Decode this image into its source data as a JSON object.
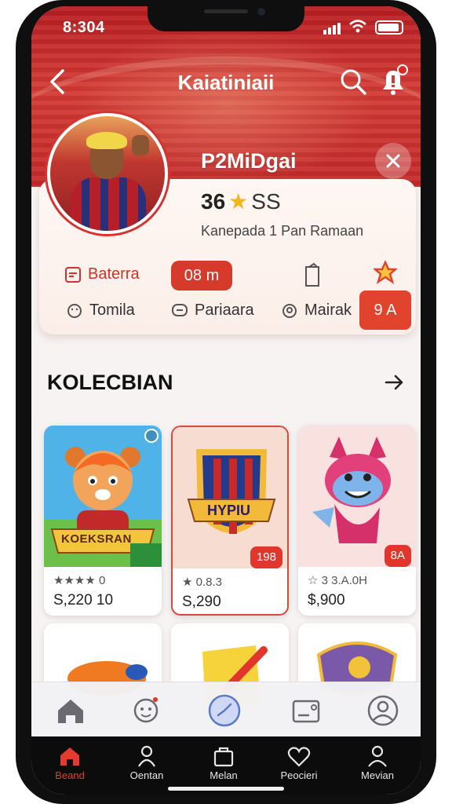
{
  "status_bar": {
    "time": "8:304"
  },
  "header": {
    "title": "Kaiatiniaii"
  },
  "profile": {
    "username": "P2MiDgai",
    "rating": "36",
    "rating_sub": "SS",
    "subtitle": "Kanepada  1 Pan Ramaan",
    "stats": {
      "row1_left": "Baterra",
      "row1_pill": "08 m",
      "row1_side": "9 A",
      "row2_a": "Tomila",
      "row2_b": "Pariaara",
      "row2_c": "Mairak"
    }
  },
  "collection": {
    "title": "KOLECBIAN",
    "items": [
      {
        "art_label": "KOEKSRAN",
        "meta": "★★★★ 0",
        "price": "S,220 10"
      },
      {
        "art_label": "HYPIU",
        "meta": "★ 0.8.3",
        "price": "S,290",
        "tag": "198"
      },
      {
        "art_label": "",
        "meta": "☆ 3 3.A.0H",
        "price": "$,900",
        "tag": "8A"
      }
    ]
  },
  "tabbar_bottom": {
    "items": [
      {
        "label": "Beand"
      },
      {
        "label": "Oentan"
      },
      {
        "label": "Melan"
      },
      {
        "label": "Peocieri"
      },
      {
        "label": "Mevian"
      }
    ]
  },
  "colors": {
    "brand_red": "#d5302a",
    "hero_red": "#c42b2a",
    "star": "#f2b51c"
  }
}
